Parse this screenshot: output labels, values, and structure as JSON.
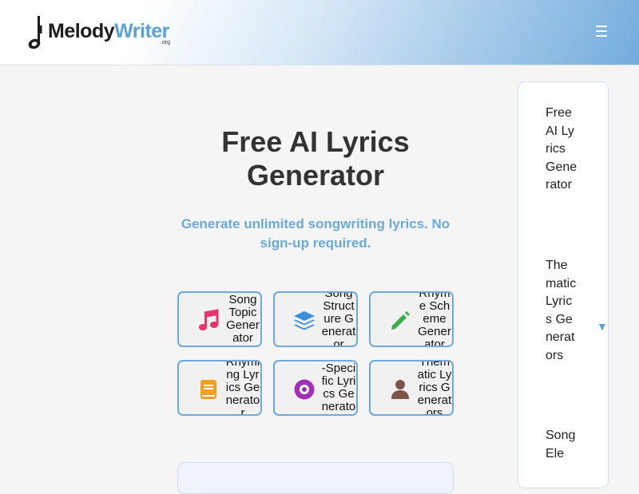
{
  "header": {
    "logo": {
      "melody": "Melody",
      "writer": "Writer",
      "org": ".org"
    },
    "menu_icon": "☰"
  },
  "hero": {
    "title_line1": "Free AI Lyrics",
    "title_line2": "Generator",
    "subtitle": "Generate unlimited songwriting lyrics. No sign-up required."
  },
  "tools": [
    {
      "label": "Song Topic Generator",
      "icon": "music-note-icon",
      "color": "#e8336d"
    },
    {
      "label": "Song Structure Generator",
      "icon": "layers-icon",
      "color": "#3b8fd9"
    },
    {
      "label": "Rhyme Scheme Generator",
      "icon": "pencil-icon",
      "color": "#3dab4a"
    },
    {
      "label": "Rhyming Lyrics Generator",
      "icon": "book-icon",
      "color": "#f0a020"
    },
    {
      "label": "Genre-Specific Lyrics Generator",
      "icon": "vinyl-record-icon",
      "color": "#a030b8"
    },
    {
      "label": "Thematic Lyrics Generators",
      "icon": "user-icon",
      "color": "#7a5548"
    }
  ],
  "sidebar": {
    "items": [
      {
        "label": "Free AI Lyrics Generator"
      },
      {
        "label": "Thematic Lyrics Generators"
      },
      {
        "label": "Song Ele"
      }
    ],
    "caret": "▼"
  },
  "colors": {
    "accent": "#6fa8dc",
    "title": "#333333",
    "subtitle": "#6aaada"
  }
}
